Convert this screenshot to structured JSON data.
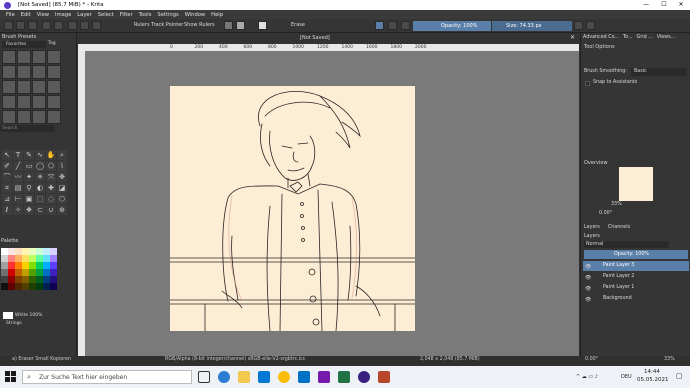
{
  "window": {
    "title": "[Not Saved]  (85.7 MiB)  * - Krita",
    "minimize": "—",
    "maximize": "☐",
    "close": "✕"
  },
  "menu": [
    "File",
    "Edit",
    "View",
    "Image",
    "Layer",
    "Select",
    "Filter",
    "Tools",
    "Settings",
    "Window",
    "Help"
  ],
  "toolbar": {
    "rulers_track_pointer": "Rulers Track Pointer",
    "show_rulers": "Show Rulers",
    "blend_mode": "Erase",
    "opacity": "Opacity: 100%",
    "size": "Size: 74.33 px"
  },
  "document_tab": "[Not Saved]",
  "ruler_ticks": [
    "0",
    "200",
    "400",
    "600",
    "800",
    "1000",
    "1200",
    "1400",
    "1600",
    "1800",
    "2000"
  ],
  "left_panel": {
    "brush_presets_title": "Brush Presets",
    "favorites": "Favorites",
    "tag": "Tag",
    "search_placeholder": "Search",
    "palette_title": "Palette",
    "white_label": "White 100%",
    "strings_label": "Strings"
  },
  "right_panel": {
    "tabs": [
      "Advanced Co...",
      "To...",
      "Grid ...",
      "Views..."
    ],
    "tool_options_title": "Tool Options",
    "brush_smoothing_label": "Brush Smoothing:",
    "brush_smoothing_value": "Basic",
    "snap_label": "Snap to Assistants",
    "overview_title": "Overview",
    "zoom_value": "33%",
    "rotation_value": "0.00°",
    "layers_tabs": [
      "Layers",
      "Channels"
    ],
    "blend_mode": "Normal",
    "opacity": "Opacity:  100%",
    "layers": [
      "Paint Layer 3",
      "Paint Layer 2",
      "Paint Layer 1",
      "Background"
    ]
  },
  "status_bar": {
    "brush_name": "a) Eraser Small Kopieren",
    "color_info": "RGB/Alpha (8-bit integer/channel)  sRGB-elle-V2-srgbtrc.icc",
    "dimensions": "2,048 x 2,048 (85.7 MiB)",
    "rotation": "0.00°",
    "zoom": "33%"
  },
  "taskbar": {
    "search_placeholder": "Zur Suche Text hier eingeben",
    "time": "14:44",
    "date": "05.05.2021",
    "lang": "DEU"
  }
}
